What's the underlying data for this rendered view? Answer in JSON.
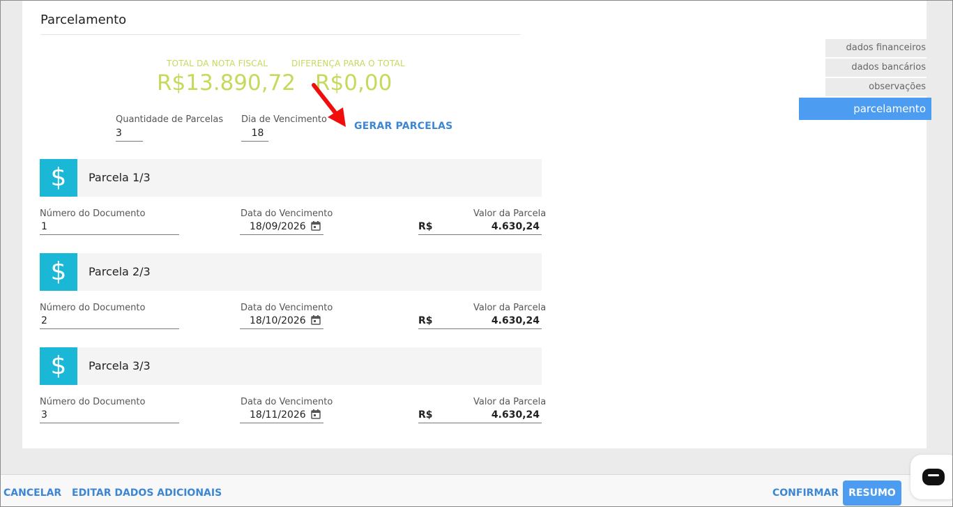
{
  "section": {
    "title": "Parcelamento"
  },
  "totals": {
    "total_label": "TOTAL DA NOTA FISCAL",
    "total_value": "R$13.890,72",
    "diff_label": "DIFERENÇA PARA O TOTAL",
    "diff_value": "R$0,00"
  },
  "config": {
    "qty_label": "Quantidade de Parcelas",
    "qty_value": "3",
    "day_label": "Dia de Vencimento",
    "day_value": "18",
    "gerar_label": "GERAR PARCELAS"
  },
  "parcelas": [
    {
      "title": "Parcela 1/3",
      "doc_label": "Número do Documento",
      "doc_value": "1",
      "date_label": "Data do Vencimento",
      "date_value": "18/09/2026",
      "valor_label": "Valor da Parcela",
      "currency": "R$",
      "valor_value": "4.630,24"
    },
    {
      "title": "Parcela 2/3",
      "doc_label": "Número do Documento",
      "doc_value": "2",
      "date_label": "Data do Vencimento",
      "date_value": "18/10/2026",
      "valor_label": "Valor da Parcela",
      "currency": "R$",
      "valor_value": "4.630,24"
    },
    {
      "title": "Parcela 3/3",
      "doc_label": "Número do Documento",
      "doc_value": "3",
      "date_label": "Data do Vencimento",
      "date_value": "18/11/2026",
      "valor_label": "Valor da Parcela",
      "currency": "R$",
      "valor_value": "4.630,24"
    }
  ],
  "icons": {
    "parcela": "dollar-icon",
    "date": "calendar-icon",
    "chat": "chat-icon"
  },
  "side_nav": [
    {
      "label": "dados financeiros"
    },
    {
      "label": "dados bancários"
    },
    {
      "label": "observações"
    },
    {
      "label": "parcelamento",
      "active": true
    }
  ],
  "footer": {
    "cancelar": "CANCELAR",
    "editar": "EDITAR DADOS ADICIONAIS",
    "confirmar": "CONFIRMAR",
    "resumo": "RESUMO"
  },
  "colors": {
    "accent": "#4c9cf1",
    "link": "#3c86d6",
    "totals": "#c5d95a",
    "parcela_icon": "#1ab8d6"
  },
  "dollar_glyph": "$"
}
